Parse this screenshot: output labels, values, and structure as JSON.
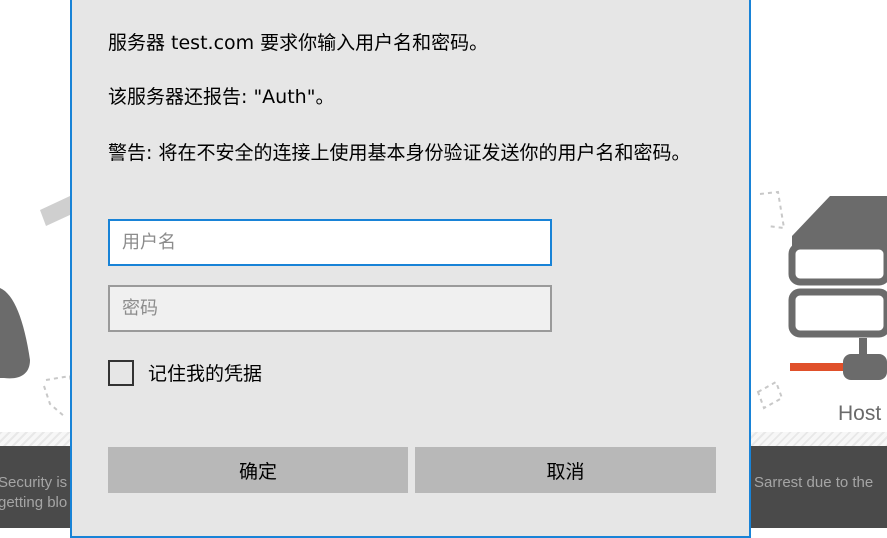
{
  "background": {
    "footer_left": "Security is\ngetting blo",
    "footer_right": "Sarrest due to the",
    "host_label": "Host"
  },
  "dialog": {
    "message_1": "服务器 test.com 要求你输入用户名和密码。",
    "message_2": "该服务器还报告: \"Auth\"。",
    "message_3": "警告: 将在不安全的连接上使用基本身份验证发送你的用户名和密码。",
    "username": {
      "value": "",
      "placeholder": "用户名"
    },
    "password": {
      "value": "",
      "placeholder": "密码"
    },
    "remember_label": "记住我的凭据",
    "remember_checked": false,
    "ok_label": "确定",
    "cancel_label": "取消"
  },
  "colors": {
    "accent": "#1883d7",
    "dialog_bg": "#e6e6e6",
    "button_bg": "#b8b8b8",
    "footer_bg": "#4a4a4a",
    "server_red": "#e0502a",
    "server_gray": "#6b6b6b"
  },
  "icons": {
    "background_left_art": "padlock-illustration",
    "background_right_art": "server-host-illustration"
  }
}
